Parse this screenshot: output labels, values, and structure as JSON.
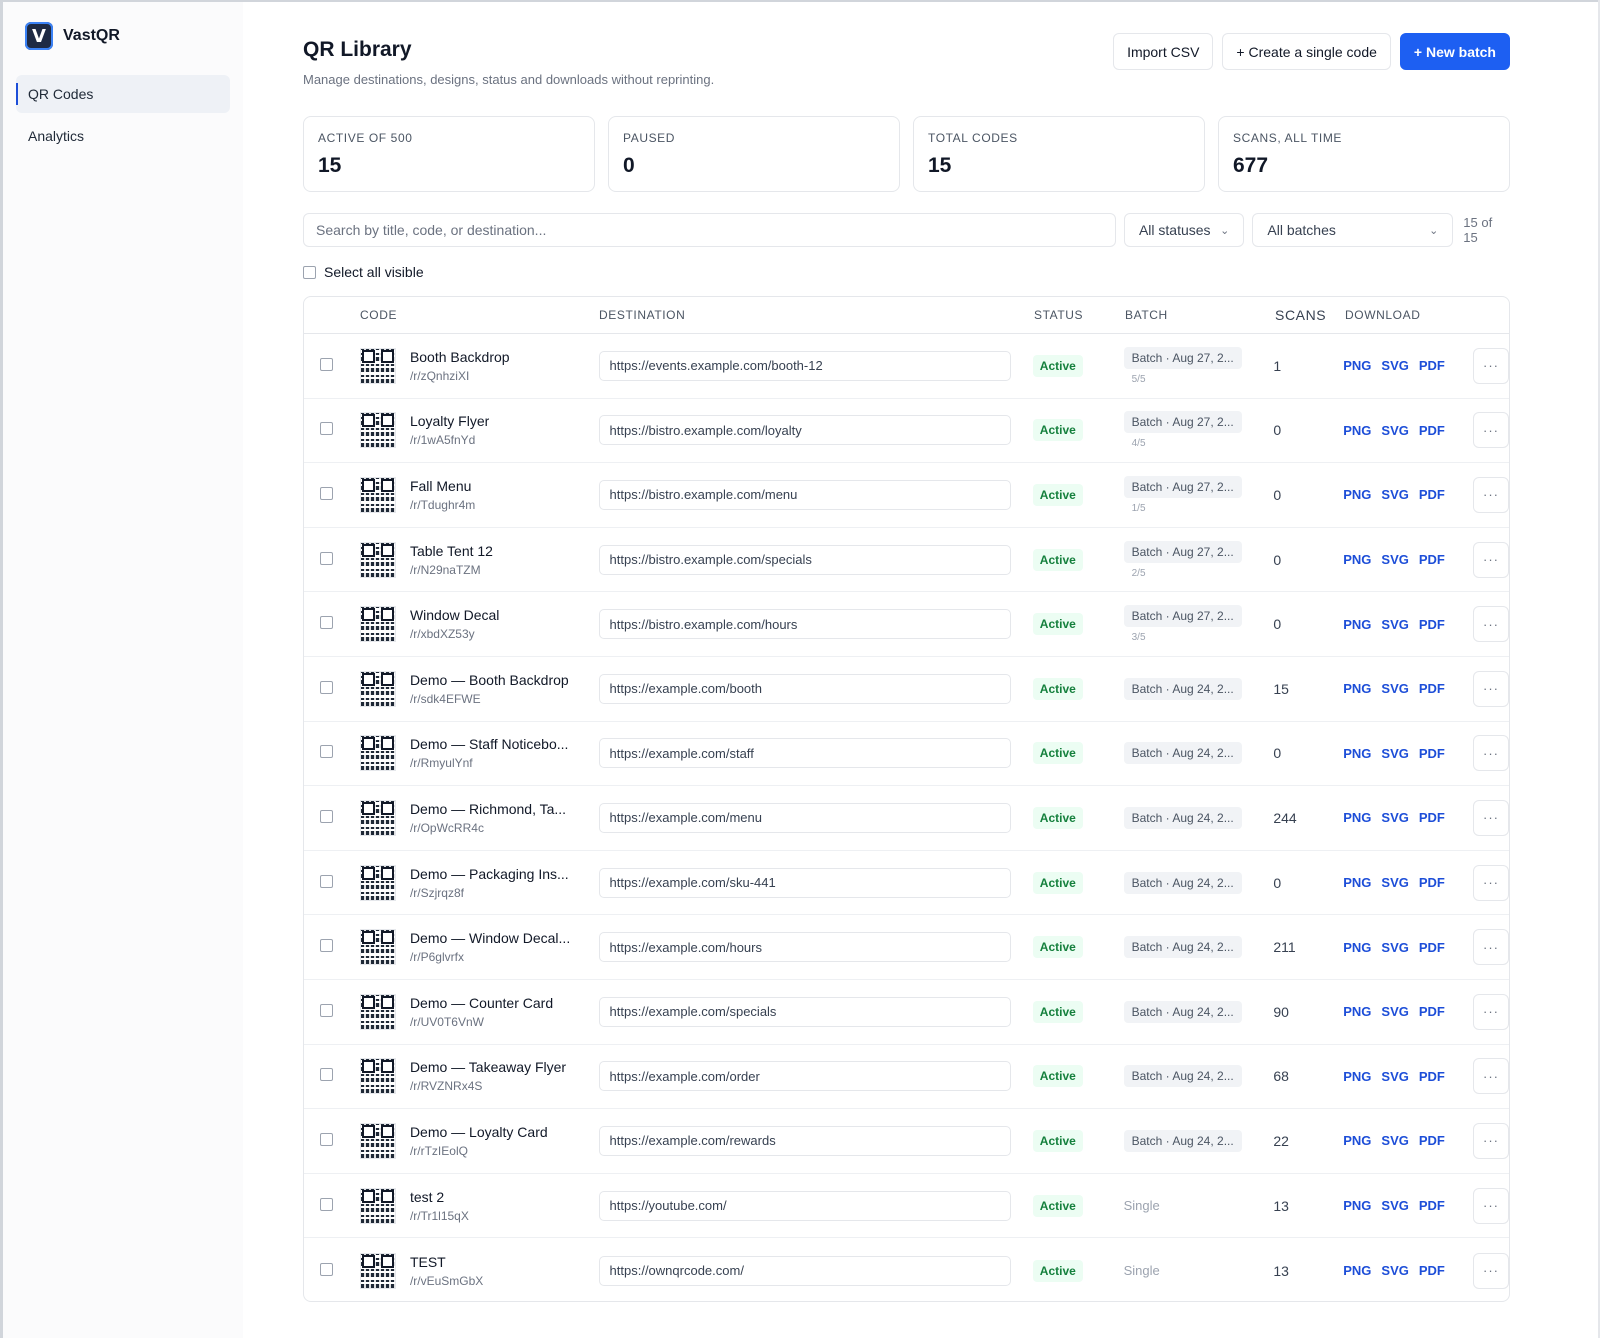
{
  "app": {
    "name": "VastQR"
  },
  "sidebar": {
    "items": [
      {
        "label": "QR Codes"
      },
      {
        "label": "Analytics"
      }
    ]
  },
  "header": {
    "title": "QR Library",
    "subtitle": "Manage destinations, designs, status and downloads without reprinting.",
    "import_label": "Import CSV",
    "single_label": "+ Create a single code",
    "batch_label": "+ New batch"
  },
  "stats": [
    {
      "label": "ACTIVE OF 500",
      "value": "15"
    },
    {
      "label": "PAUSED",
      "value": "0"
    },
    {
      "label": "TOTAL CODES",
      "value": "15"
    },
    {
      "label": "SCANS, ALL TIME",
      "value": "677"
    }
  ],
  "filters": {
    "search_placeholder": "Search by title, code, or destination...",
    "status_value": "All statuses",
    "batch_value": "All batches",
    "count": "15 of 15",
    "select_all_label": "Select all visible"
  },
  "table": {
    "headers": {
      "code": "CODE",
      "destination": "DESTINATION",
      "status": "STATUS",
      "batch": "BATCH",
      "scans": "SCANS",
      "download": "DOWNLOAD"
    },
    "rows": [
      {
        "title": "Booth Backdrop",
        "slug": "/r/zQnhziXI",
        "destination": "https://events.example.com/booth-12",
        "status": "Active",
        "batch": "Batch · Aug 27, 2...",
        "batch_sub": "5/5",
        "scans": "1"
      },
      {
        "title": "Loyalty Flyer",
        "slug": "/r/1wA5fnYd",
        "destination": "https://bistro.example.com/loyalty",
        "status": "Active",
        "batch": "Batch · Aug 27, 2...",
        "batch_sub": "4/5",
        "scans": "0"
      },
      {
        "title": "Fall Menu",
        "slug": "/r/Tdughr4m",
        "destination": "https://bistro.example.com/menu",
        "status": "Active",
        "batch": "Batch · Aug 27, 2...",
        "batch_sub": "1/5",
        "scans": "0"
      },
      {
        "title": "Table Tent 12",
        "slug": "/r/N29naTZM",
        "destination": "https://bistro.example.com/specials",
        "status": "Active",
        "batch": "Batch · Aug 27, 2...",
        "batch_sub": "2/5",
        "scans": "0"
      },
      {
        "title": "Window Decal",
        "slug": "/r/xbdXZ53y",
        "destination": "https://bistro.example.com/hours",
        "status": "Active",
        "batch": "Batch · Aug 27, 2...",
        "batch_sub": "3/5",
        "scans": "0"
      },
      {
        "title": "Demo — Booth Backdrop",
        "slug": "/r/sdk4EFWE",
        "destination": "https://example.com/booth",
        "status": "Active",
        "batch": "Batch · Aug 24, 2...",
        "batch_sub": "",
        "scans": "15"
      },
      {
        "title": "Demo — Staff Noticebo...",
        "slug": "/r/RmyulYnf",
        "destination": "https://example.com/staff",
        "status": "Active",
        "batch": "Batch · Aug 24, 2...",
        "batch_sub": "",
        "scans": "0"
      },
      {
        "title": "Demo — Richmond, Ta...",
        "slug": "/r/OpWcRR4c",
        "destination": "https://example.com/menu",
        "status": "Active",
        "batch": "Batch · Aug 24, 2...",
        "batch_sub": "",
        "scans": "244"
      },
      {
        "title": "Demo — Packaging Ins...",
        "slug": "/r/Szjrqz8f",
        "destination": "https://example.com/sku-441",
        "status": "Active",
        "batch": "Batch · Aug 24, 2...",
        "batch_sub": "",
        "scans": "0"
      },
      {
        "title": "Demo — Window Decal...",
        "slug": "/r/P6glvrfx",
        "destination": "https://example.com/hours",
        "status": "Active",
        "batch": "Batch · Aug 24, 2...",
        "batch_sub": "",
        "scans": "211"
      },
      {
        "title": "Demo — Counter Card",
        "slug": "/r/UV0T6VnW",
        "destination": "https://example.com/specials",
        "status": "Active",
        "batch": "Batch · Aug 24, 2...",
        "batch_sub": "",
        "scans": "90"
      },
      {
        "title": "Demo — Takeaway Flyer",
        "slug": "/r/RVZNRx4S",
        "destination": "https://example.com/order",
        "status": "Active",
        "batch": "Batch · Aug 24, 2...",
        "batch_sub": "",
        "scans": "68"
      },
      {
        "title": "Demo — Loyalty Card",
        "slug": "/r/rTzIEolQ",
        "destination": "https://example.com/rewards",
        "status": "Active",
        "batch": "Batch · Aug 24, 2...",
        "batch_sub": "",
        "scans": "22"
      },
      {
        "title": "test 2",
        "slug": "/r/Tr1l15qX",
        "destination": "https://youtube.com/",
        "status": "Active",
        "batch": "",
        "single": "Single",
        "batch_sub": "",
        "scans": "13"
      },
      {
        "title": "TEST",
        "slug": "/r/vEuSmGbX",
        "destination": "https://ownqrcode.com/",
        "status": "Active",
        "batch": "",
        "single": "Single",
        "batch_sub": "",
        "scans": "13"
      }
    ],
    "download_labels": [
      "PNG",
      "SVG",
      "PDF"
    ],
    "more_label": "···"
  },
  "icons": {
    "logo": "v-logo-icon",
    "chevron": "chevron-down-icon",
    "qr": "qr-code-icon",
    "more": "ellipsis-icon"
  },
  "colors": {
    "primary": "#1d5ff2",
    "active_badge_bg": "#ecfdf3",
    "active_badge_text": "#15803d",
    "link": "#1d4ed8"
  }
}
